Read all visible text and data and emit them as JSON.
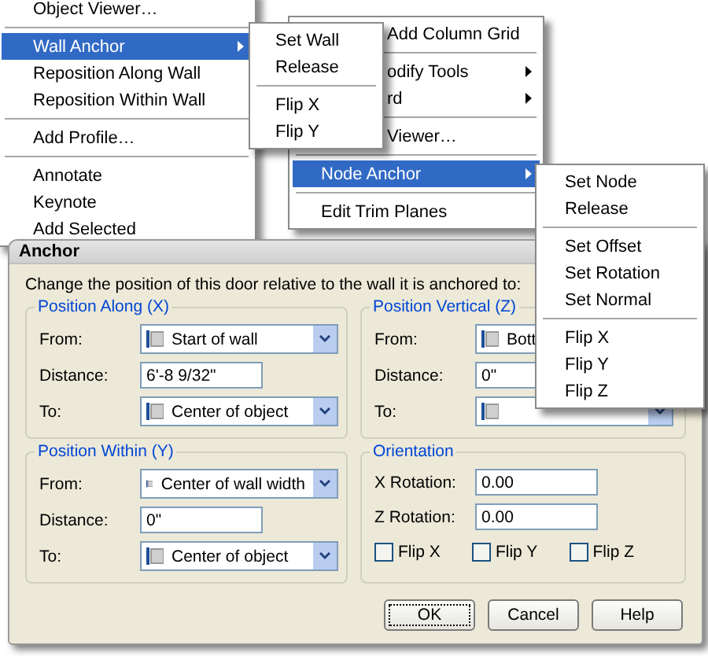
{
  "context_menu": {
    "items": [
      {
        "kind": "item",
        "label": "Object Viewer…",
        "selected": false,
        "has_submenu": false
      },
      {
        "kind": "separator"
      },
      {
        "kind": "item",
        "label": "Wall Anchor",
        "selected": true,
        "has_submenu": true
      },
      {
        "kind": "item",
        "label": "Reposition Along Wall",
        "selected": false,
        "has_submenu": false
      },
      {
        "kind": "item",
        "label": "Reposition Within Wall",
        "selected": false,
        "has_submenu": false
      },
      {
        "kind": "separator"
      },
      {
        "kind": "item",
        "label": "Add Profile…",
        "selected": false,
        "has_submenu": false
      },
      {
        "kind": "separator"
      },
      {
        "kind": "item",
        "label": "Annotate",
        "selected": false,
        "has_submenu": false
      },
      {
        "kind": "item",
        "label": "Keynote",
        "selected": false,
        "has_submenu": false
      },
      {
        "kind": "item",
        "label": "Add Selected",
        "selected": false,
        "has_submenu": false
      }
    ]
  },
  "wall_anchor_submenu": {
    "items": [
      {
        "kind": "item",
        "label": "Set Wall",
        "selected": false,
        "has_submenu": false
      },
      {
        "kind": "item",
        "label": "Release",
        "selected": false,
        "has_submenu": false
      },
      {
        "kind": "separator"
      },
      {
        "kind": "item",
        "label": "Flip X",
        "selected": false,
        "has_submenu": false
      },
      {
        "kind": "item",
        "label": "Flip Y",
        "selected": false,
        "has_submenu": false
      }
    ]
  },
  "second_menu": {
    "items": [
      {
        "kind": "covered",
        "label": "Add Column Grid",
        "selected": false,
        "has_submenu": false
      },
      {
        "kind": "separator"
      },
      {
        "kind": "covered",
        "label": "odify Tools",
        "selected": false,
        "has_submenu": true
      },
      {
        "kind": "covered",
        "label": "rd",
        "selected": false,
        "has_submenu": true
      },
      {
        "kind": "separator"
      },
      {
        "kind": "covered",
        "label": "Viewer…",
        "selected": false,
        "has_submenu": false
      },
      {
        "kind": "separator"
      },
      {
        "kind": "item",
        "label": "Node Anchor",
        "selected": true,
        "has_submenu": true
      },
      {
        "kind": "separator"
      },
      {
        "kind": "item",
        "label": "Edit Trim Planes",
        "selected": false,
        "has_submenu": false
      }
    ]
  },
  "node_anchor_submenu": {
    "items": [
      {
        "kind": "item",
        "label": "Set Node",
        "selected": false,
        "has_submenu": false
      },
      {
        "kind": "item",
        "label": "Release",
        "selected": false,
        "has_submenu": false
      },
      {
        "kind": "separator"
      },
      {
        "kind": "item",
        "label": "Set Offset",
        "selected": false,
        "has_submenu": false
      },
      {
        "kind": "item",
        "label": "Set Rotation",
        "selected": false,
        "has_submenu": false
      },
      {
        "kind": "item",
        "label": "Set Normal",
        "selected": false,
        "has_submenu": false
      },
      {
        "kind": "separator"
      },
      {
        "kind": "item",
        "label": "Flip X",
        "selected": false,
        "has_submenu": false
      },
      {
        "kind": "item",
        "label": "Flip Y",
        "selected": false,
        "has_submenu": false
      },
      {
        "kind": "item",
        "label": "Flip Z",
        "selected": false,
        "has_submenu": false
      }
    ]
  },
  "dialog": {
    "title": "Anchor",
    "description": "Change the position of this door relative to the wall it is anchored to:",
    "groups": [
      {
        "title": "Position Along (X)",
        "fields": [
          {
            "kind": "combo",
            "label": "From:",
            "value": "Start of wall"
          },
          {
            "kind": "text",
            "label": "Distance:",
            "value": "6'-8 9/32\""
          },
          {
            "kind": "combo",
            "label": "To:",
            "value": "Center of object"
          }
        ]
      },
      {
        "title": "Position Vertical (Z)",
        "fields": [
          {
            "kind": "combo",
            "label": "From:",
            "value": "Bott"
          },
          {
            "kind": "text",
            "label": "Distance:",
            "value": "0\""
          },
          {
            "kind": "combo",
            "label": "To:"
          }
        ]
      },
      {
        "title": "Position Within (Y)",
        "fields": [
          {
            "kind": "combo",
            "label": "From:",
            "value": "Center of wall width"
          },
          {
            "kind": "text",
            "label": "Distance:",
            "value": "0\""
          },
          {
            "kind": "combo",
            "label": "To:",
            "value": "Center of object"
          }
        ]
      }
    ],
    "orientation": {
      "title": "Orientation",
      "fields": [
        {
          "label": "X Rotation:",
          "value": "0.00"
        },
        {
          "label": "Z Rotation:",
          "value": "0.00"
        }
      ],
      "checkboxes": [
        {
          "label": "Flip X",
          "checked": false
        },
        {
          "label": "Flip Y",
          "checked": false
        },
        {
          "label": "Flip Z",
          "checked": false
        }
      ]
    },
    "buttons": [
      {
        "label": "OK",
        "focused": true
      },
      {
        "label": "Cancel",
        "focused": false
      },
      {
        "label": "Help",
        "focused": false
      }
    ]
  }
}
